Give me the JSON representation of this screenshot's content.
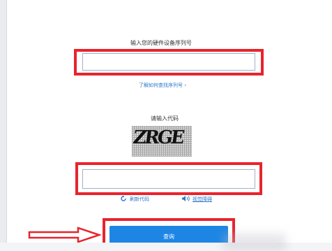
{
  "form": {
    "serial_label": "输入您的硬件设备序列号",
    "serial_value": "",
    "find_serial_link": "了解如何查找序列号 ›",
    "code_label": "请输入代码",
    "captcha_text": "ZRGE",
    "code_value": "",
    "refresh_label": "刷新代码",
    "audio_label": "视觉障碍",
    "submit_label": "查询"
  },
  "colors": {
    "highlight_red": "#e8242c",
    "link_blue": "#2c7ac9",
    "button_blue": "#1d86e4"
  }
}
